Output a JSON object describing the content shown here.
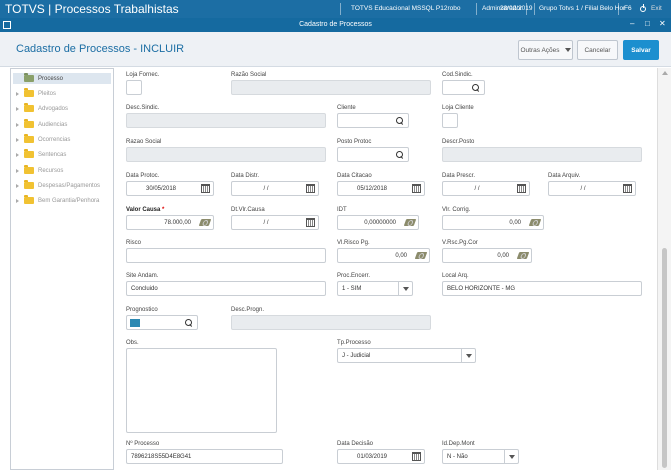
{
  "topbar": {
    "title": "TOTVS | Processos Trabalhistas",
    "environment": "TOTVS Educacional MSSQL P12robo",
    "user": "Administrador",
    "date": "28/02/2019",
    "company": "Grupo Totvs 1 / Filial Belo Hor",
    "f6": "F6",
    "exit": "Exit"
  },
  "dialog": {
    "title": "Cadastro de Processos",
    "ctl_min": "–",
    "ctl_max": "□",
    "ctl_close": "✕"
  },
  "header": {
    "title": "Cadastro de Processos - INCLUIR",
    "outras_acoes": "Outras Ações",
    "cancelar": "Cancelar",
    "salvar": "Salvar"
  },
  "sidebar": {
    "items": [
      {
        "label": "Processo",
        "selected": true
      },
      {
        "label": "Pleitos"
      },
      {
        "label": "Advogados"
      },
      {
        "label": "Audiencias"
      },
      {
        "label": "Ocorrencias"
      },
      {
        "label": "Sentencas"
      },
      {
        "label": "Recursos"
      },
      {
        "label": "Despesas/Pagamentos"
      },
      {
        "label": "Bem Garantia/Penhora"
      }
    ]
  },
  "form": {
    "loja_fornec": {
      "label": "Loja Fornec.",
      "value": ""
    },
    "razao_social_1": {
      "label": "Razão Social",
      "value": ""
    },
    "cod_sindic": {
      "label": "Cod.Sindic.",
      "value": ""
    },
    "desc_sindic": {
      "label": "Desc.Sindic.",
      "value": ""
    },
    "cliente": {
      "label": "Cliente",
      "value": ""
    },
    "loja_cliente": {
      "label": "Loja Cliente",
      "value": ""
    },
    "razao_social_2": {
      "label": "Razao Social",
      "value": ""
    },
    "posto_protoc": {
      "label": "Posto Protoc",
      "value": ""
    },
    "descr_posto": {
      "label": "Descr.Posto",
      "value": ""
    },
    "data_protoc": {
      "label": "Data Protoc.",
      "value": "30/05/2018"
    },
    "data_distr": {
      "label": "Data Distr.",
      "value": "/ /"
    },
    "data_citacao": {
      "label": "Data Citacao",
      "value": "05/12/2018"
    },
    "data_prescr": {
      "label": "Data Prescr.",
      "value": "/ /"
    },
    "data_arquiv": {
      "label": "Data Arquiv.",
      "value": "/ /"
    },
    "valor_causa": {
      "label": "Valor Causa",
      "required": "*",
      "value": "78.000,00"
    },
    "dt_vlr_causa": {
      "label": "Dt.Vlr.Causa",
      "value": "/ /"
    },
    "idt": {
      "label": "IDT",
      "value": "0,00000000"
    },
    "vlr_corrig": {
      "label": "Vlr. Corrig.",
      "value": "0,00"
    },
    "risco": {
      "label": "Risco",
      "value": ""
    },
    "vl_risco_pg": {
      "label": "Vl.Risco Pg.",
      "value": "0,00"
    },
    "v_rsc_pg_cor": {
      "label": "V.Rsc.Pg.Cor",
      "value": "0,00"
    },
    "site_andam": {
      "label": "Site Andam.",
      "value": "Concluido"
    },
    "proc_encerr": {
      "label": "Proc.Encerr.",
      "value": "1 - SIM"
    },
    "local_arq": {
      "label": "Local Arq.",
      "value": "BELO HORIZONTE - MG"
    },
    "prognostico": {
      "label": "Prognostico",
      "value": "",
      "swatch_color": "#2b88b2"
    },
    "desc_progn": {
      "label": "Desc.Progn.",
      "value": ""
    },
    "obs": {
      "label": "Obs.",
      "value": ""
    },
    "tp_processo": {
      "label": "Tp.Processo",
      "value": "J - Judicial"
    },
    "num_processo": {
      "label": "Nº Processo",
      "value": "7896218S55D4E8G41"
    },
    "data_decisao": {
      "label": "Data Decisão",
      "value": "01/03/2019"
    },
    "id_dep_mont": {
      "label": "Id.Dep.Mont",
      "value": "N - Não"
    }
  },
  "colors": {
    "brand": "#1c6ea4",
    "accent": "#1c8fcf"
  }
}
